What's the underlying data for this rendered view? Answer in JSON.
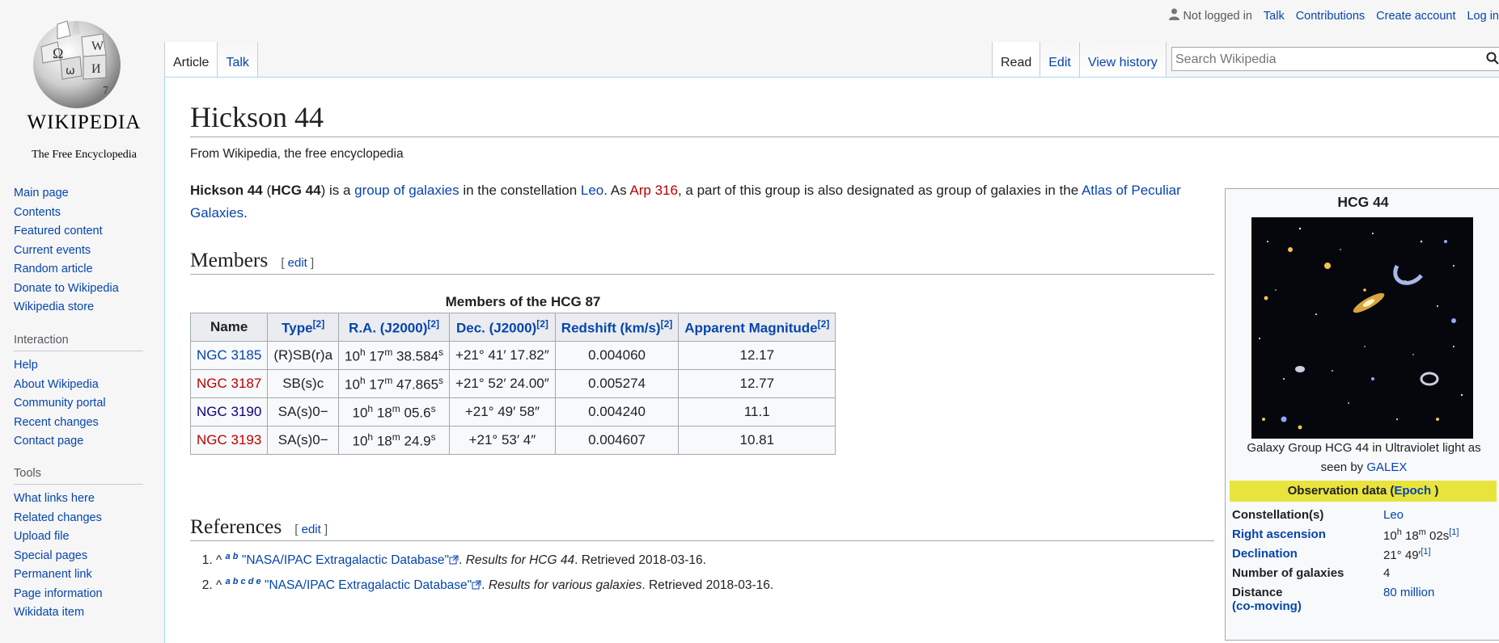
{
  "logo": {
    "wordmark": "WIKIPEDIA",
    "tagline": "The Free Encyclopedia"
  },
  "nav": {
    "main": [
      "Main page",
      "Contents",
      "Featured content",
      "Current events",
      "Random article",
      "Donate to Wikipedia",
      "Wikipedia store"
    ],
    "interaction_title": "Interaction",
    "interaction": [
      "Help",
      "About Wikipedia",
      "Community portal",
      "Recent changes",
      "Contact page"
    ],
    "tools_title": "Tools",
    "tools": [
      "What links here",
      "Related changes",
      "Upload file",
      "Special pages",
      "Permanent link",
      "Page information",
      "Wikidata item"
    ]
  },
  "personal": {
    "not_logged_in": "Not logged in",
    "talk": "Talk",
    "contributions": "Contributions",
    "create_account": "Create account",
    "log_in": "Log in"
  },
  "tabs": {
    "article": "Article",
    "talk": "Talk",
    "read": "Read",
    "edit": "Edit",
    "history": "View history"
  },
  "search": {
    "placeholder": "Search Wikipedia"
  },
  "page": {
    "title": "Hickson 44",
    "subtitle": "From Wikipedia, the free encyclopedia",
    "lead": {
      "b1": "Hickson 44",
      "t1": " (",
      "b2": "HCG 44",
      "t2": ") is a ",
      "l1": "group of galaxies",
      "t3": " in the constellation ",
      "l2": "Leo",
      "t4": ". As ",
      "l3": "Arp 316",
      "t5": ", a part of this group is also designated as group of galaxies in the ",
      "l4": "Atlas of Peculiar Galaxies",
      "t6": "."
    },
    "edit_label": "edit",
    "members_heading": "Members",
    "table_caption": "Members of the HCG 87",
    "table_headers": [
      "Name",
      "Type",
      "R.A. (J2000)",
      "Dec. (J2000)",
      "Redshift (km/s)",
      "Apparent Magnitude"
    ],
    "ref_marker": "[2]",
    "rows": [
      {
        "name": "NGC 3185",
        "type": "(R)SB(r)a",
        "ra_h": "10",
        "ra_m": "17",
        "ra_s": "38.584",
        "dec": "+21° 41′ 17.82″",
        "z": "0.004060",
        "mag": "12.17"
      },
      {
        "name": "NGC 3187",
        "type": "SB(s)c",
        "ra_h": "10",
        "ra_m": "17",
        "ra_s": "47.865",
        "dec": "+21° 52′ 24.00″",
        "z": "0.005274",
        "mag": "12.77"
      },
      {
        "name": "NGC 3190",
        "type": "SA(s)0−",
        "ra_h": "10",
        "ra_m": "18",
        "ra_s": "05.6",
        "dec": "+21° 49′ 58″",
        "z": "0.004240",
        "mag": "11.1"
      },
      {
        "name": "NGC 3193",
        "type": "SA(s)0−",
        "ra_h": "10",
        "ra_m": "18",
        "ra_s": "24.9",
        "dec": "+21° 53′ 4″",
        "z": "0.004607",
        "mag": "10.81"
      }
    ],
    "references_heading": "References",
    "refs": [
      {
        "caret": "^",
        "backlinks": "a b",
        "title": "\"NASA/IPAC Extragalactic Database\"",
        "italic": "Results for HCG 44",
        "retrieved": ". Retrieved 2018-03-16."
      },
      {
        "caret": "^",
        "backlinks": "a b c d e",
        "title": "\"NASA/IPAC Extragalactic Database\"",
        "italic": "Results for various galaxies",
        "retrieved": ". Retrieved 2018-03-16."
      }
    ]
  },
  "infobox": {
    "title": "HCG 44",
    "caption": "Galaxy Group HCG 44 in Ultraviolet light as seen by",
    "caption_link": "GALEX",
    "header": "Observation data (",
    "header_link": "Epoch",
    "header_end": " )",
    "constellation_label": "Constellation(s)",
    "constellation_value": "Leo",
    "ra_label": "Right ascension",
    "ra_h": "10",
    "ra_m": "18",
    "ra_s": "02s",
    "ra_ref": "[1]",
    "dec_label": "Declination",
    "dec_value": "21° 49′",
    "dec_ref": "[1]",
    "num_label": "Number of galaxies",
    "num_value": "4",
    "distance_label": "Distance",
    "distance_label2": "(co-moving)",
    "distance_value": "80 million"
  }
}
